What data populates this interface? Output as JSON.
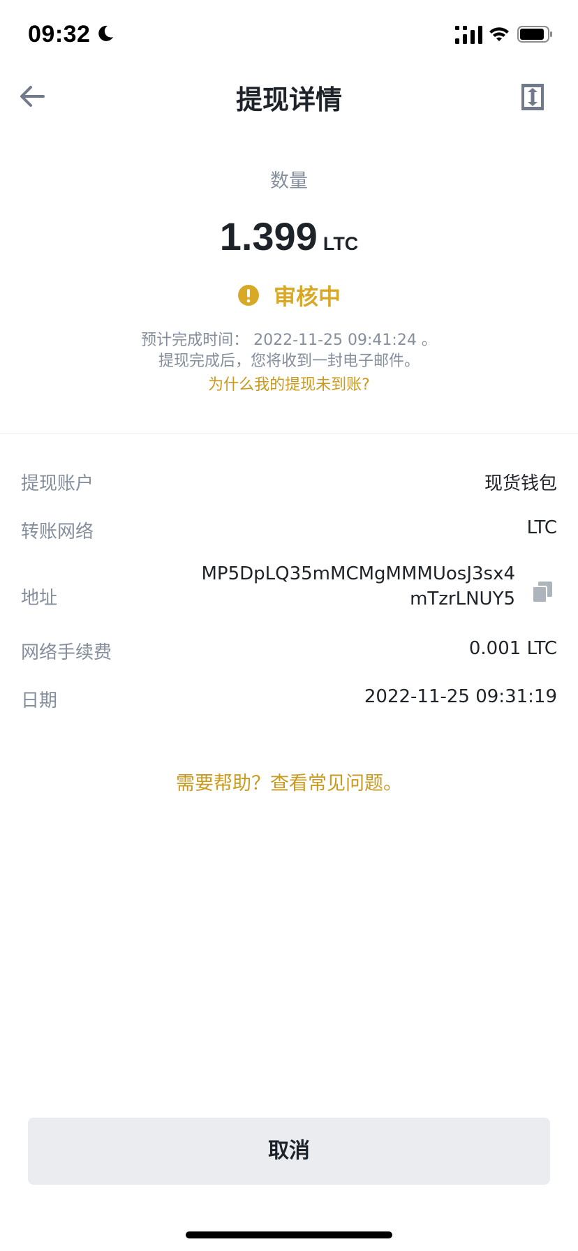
{
  "status_bar": {
    "time": "09:32"
  },
  "nav": {
    "title": "提现详情"
  },
  "summary": {
    "amount_label": "数量",
    "amount": "1.399",
    "unit": "LTC",
    "status": "审核中",
    "eta_text": "预计完成时间： 2022-11-25 09:41:24 。",
    "email_text": "提现完成后，您将收到一封电子邮件。",
    "faq_link": "为什么我的提现未到账?"
  },
  "details": {
    "account": {
      "label": "提现账户",
      "value": "现货钱包"
    },
    "network": {
      "label": "转账网络",
      "value": "LTC"
    },
    "address": {
      "label": "地址",
      "value": "MP5DpLQ35mMCMgMMMUosJ3sx4mTzrLNUY5"
    },
    "fee": {
      "label": "网络手续费",
      "value": "0.001 LTC"
    },
    "date": {
      "label": "日期",
      "value": "2022-11-25 09:31:19"
    }
  },
  "help_link": "需要帮助？查看常见问题。",
  "cancel_button": "取消",
  "colors": {
    "accent": "#d8a927",
    "link": "#c99a1e",
    "text_primary": "#1e2329",
    "text_secondary": "#848e9c",
    "button_bg": "#eaecef"
  },
  "icons": {
    "back": "arrow-left-icon",
    "download": "download-icon",
    "status": "warning-icon",
    "copy": "copy-icon"
  }
}
